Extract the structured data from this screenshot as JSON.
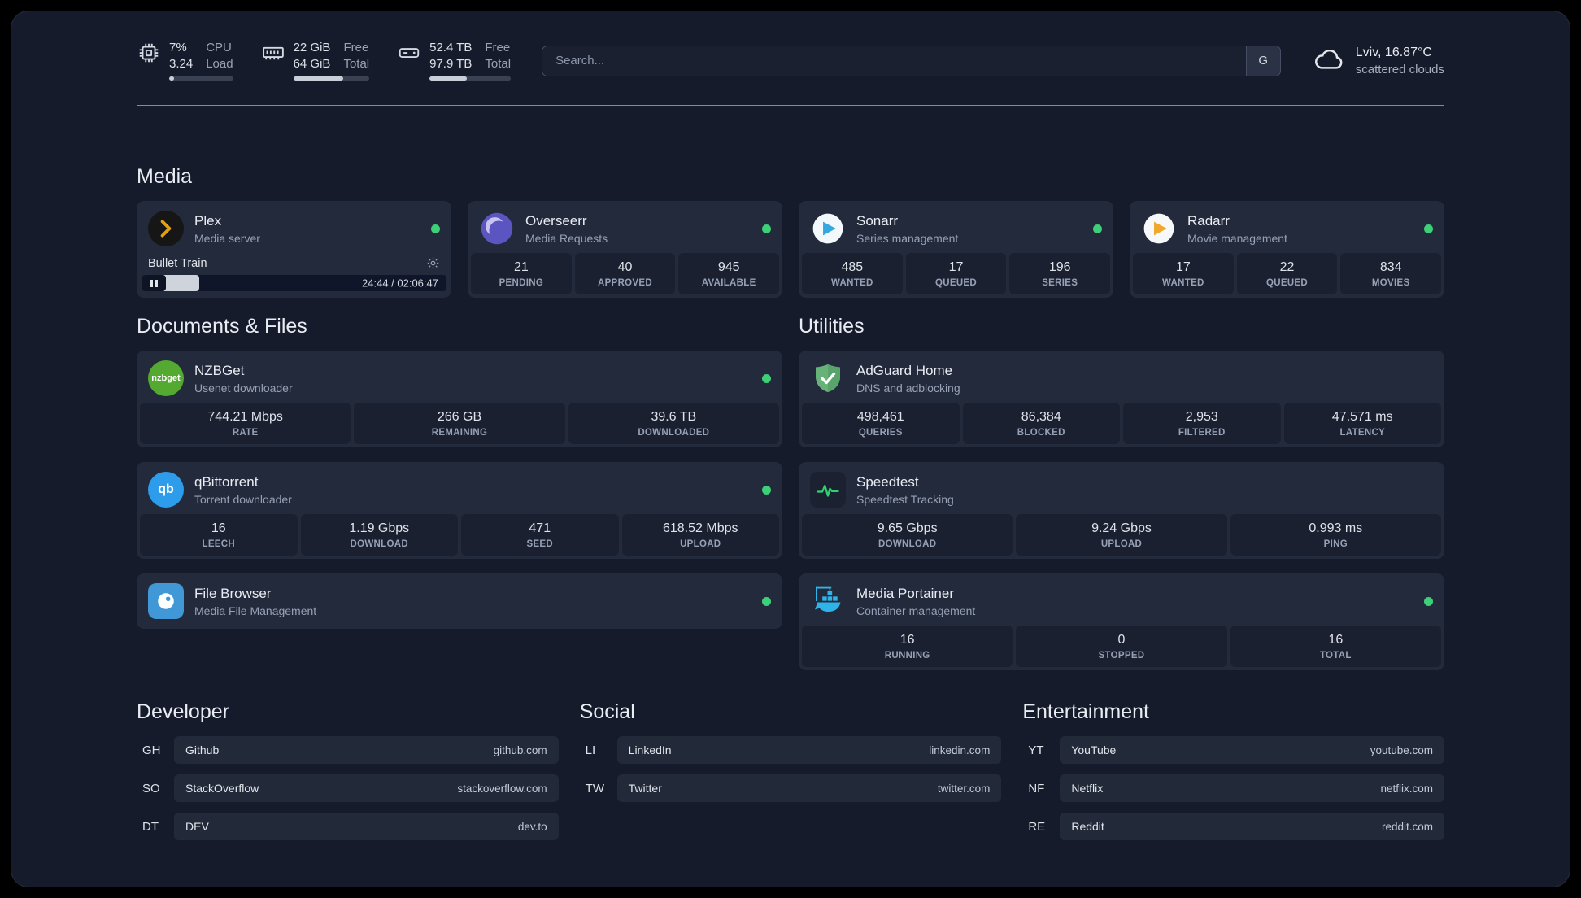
{
  "colors": {
    "background": "#161b2b",
    "card": "#232a3b",
    "stat_block": "#1a2030",
    "status_online": "#3ecf79",
    "accent_plex": "#e5a00d",
    "accent_overseerr": "#6862d9",
    "accent_sonarr": "#35a8e0",
    "accent_radarr": "#f7b129",
    "accent_nzbget": "#54a931",
    "accent_qbittorrent": "#2d9ceb",
    "accent_filebrowser": "#4098d7",
    "accent_adguard": "#67b279",
    "accent_speedtest": "#2dd36f",
    "accent_portainer": "#2fb4e9"
  },
  "topbar": {
    "cpu": {
      "value_top": "7%",
      "value_bottom": "3.24",
      "label_top": "CPU",
      "label_bottom": "Load",
      "bar_pct": 7
    },
    "ram": {
      "value_top": "22 GiB",
      "value_bottom": "64 GiB",
      "label_top": "Free",
      "label_bottom": "Total",
      "bar_pct": 66
    },
    "disk": {
      "value_top": "52.4 TB",
      "value_bottom": "97.9 TB",
      "label_top": "Free",
      "label_bottom": "Total",
      "bar_pct": 46
    },
    "search": {
      "placeholder": "Search...",
      "provider": "G"
    },
    "weather": {
      "location": "Lviv, 16.87°C",
      "condition": "scattered clouds"
    }
  },
  "media": {
    "title": "Media",
    "plex": {
      "name": "Plex",
      "desc": "Media server",
      "now_playing": "Bullet Train",
      "time": "24:44 / 02:06:47",
      "progress_pct": 19
    },
    "overseerr": {
      "name": "Overseerr",
      "desc": "Media Requests",
      "stats": [
        {
          "value": "21",
          "label": "PENDING"
        },
        {
          "value": "40",
          "label": "APPROVED"
        },
        {
          "value": "945",
          "label": "AVAILABLE"
        }
      ]
    },
    "sonarr": {
      "name": "Sonarr",
      "desc": "Series management",
      "stats": [
        {
          "value": "485",
          "label": "WANTED"
        },
        {
          "value": "17",
          "label": "QUEUED"
        },
        {
          "value": "196",
          "label": "SERIES"
        }
      ]
    },
    "radarr": {
      "name": "Radarr",
      "desc": "Movie management",
      "stats": [
        {
          "value": "17",
          "label": "WANTED"
        },
        {
          "value": "22",
          "label": "QUEUED"
        },
        {
          "value": "834",
          "label": "MOVIES"
        }
      ]
    }
  },
  "documents": {
    "title": "Documents & Files",
    "nzbget": {
      "name": "NZBGet",
      "desc": "Usenet downloader",
      "icon_text": "nzbget",
      "stats": [
        {
          "value": "744.21 Mbps",
          "label": "RATE"
        },
        {
          "value": "266 GB",
          "label": "REMAINING"
        },
        {
          "value": "39.6 TB",
          "label": "DOWNLOADED"
        }
      ]
    },
    "qbittorrent": {
      "name": "qBittorrent",
      "desc": "Torrent downloader",
      "icon_text": "qb",
      "stats": [
        {
          "value": "16",
          "label": "LEECH"
        },
        {
          "value": "1.19 Gbps",
          "label": "DOWNLOAD"
        },
        {
          "value": "471",
          "label": "SEED"
        },
        {
          "value": "618.52 Mbps",
          "label": "UPLOAD"
        }
      ]
    },
    "filebrowser": {
      "name": "File Browser",
      "desc": "Media File Management"
    }
  },
  "utilities": {
    "title": "Utilities",
    "adguard": {
      "name": "AdGuard Home",
      "desc": "DNS and adblocking",
      "stats": [
        {
          "value": "498,461",
          "label": "QUERIES"
        },
        {
          "value": "86,384",
          "label": "BLOCKED"
        },
        {
          "value": "2,953",
          "label": "FILTERED"
        },
        {
          "value": "47.571 ms",
          "label": "LATENCY"
        }
      ]
    },
    "speedtest": {
      "name": "Speedtest",
      "desc": "Speedtest Tracking",
      "stats": [
        {
          "value": "9.65 Gbps",
          "label": "DOWNLOAD"
        },
        {
          "value": "9.24 Gbps",
          "label": "UPLOAD"
        },
        {
          "value": "0.993 ms",
          "label": "PING"
        }
      ]
    },
    "portainer": {
      "name": "Media Portainer",
      "desc": "Container management",
      "stats": [
        {
          "value": "16",
          "label": "RUNNING"
        },
        {
          "value": "0",
          "label": "STOPPED"
        },
        {
          "value": "16",
          "label": "TOTAL"
        }
      ]
    }
  },
  "bookmarks": {
    "developer": {
      "title": "Developer",
      "items": [
        {
          "abbr": "GH",
          "name": "Github",
          "domain": "github.com"
        },
        {
          "abbr": "SO",
          "name": "StackOverflow",
          "domain": "stackoverflow.com"
        },
        {
          "abbr": "DT",
          "name": "DEV",
          "domain": "dev.to"
        }
      ]
    },
    "social": {
      "title": "Social",
      "items": [
        {
          "abbr": "LI",
          "name": "LinkedIn",
          "domain": "linkedin.com"
        },
        {
          "abbr": "TW",
          "name": "Twitter",
          "domain": "twitter.com"
        }
      ]
    },
    "entertainment": {
      "title": "Entertainment",
      "items": [
        {
          "abbr": "YT",
          "name": "YouTube",
          "domain": "youtube.com"
        },
        {
          "abbr": "NF",
          "name": "Netflix",
          "domain": "netflix.com"
        },
        {
          "abbr": "RE",
          "name": "Reddit",
          "domain": "reddit.com"
        }
      ]
    }
  }
}
